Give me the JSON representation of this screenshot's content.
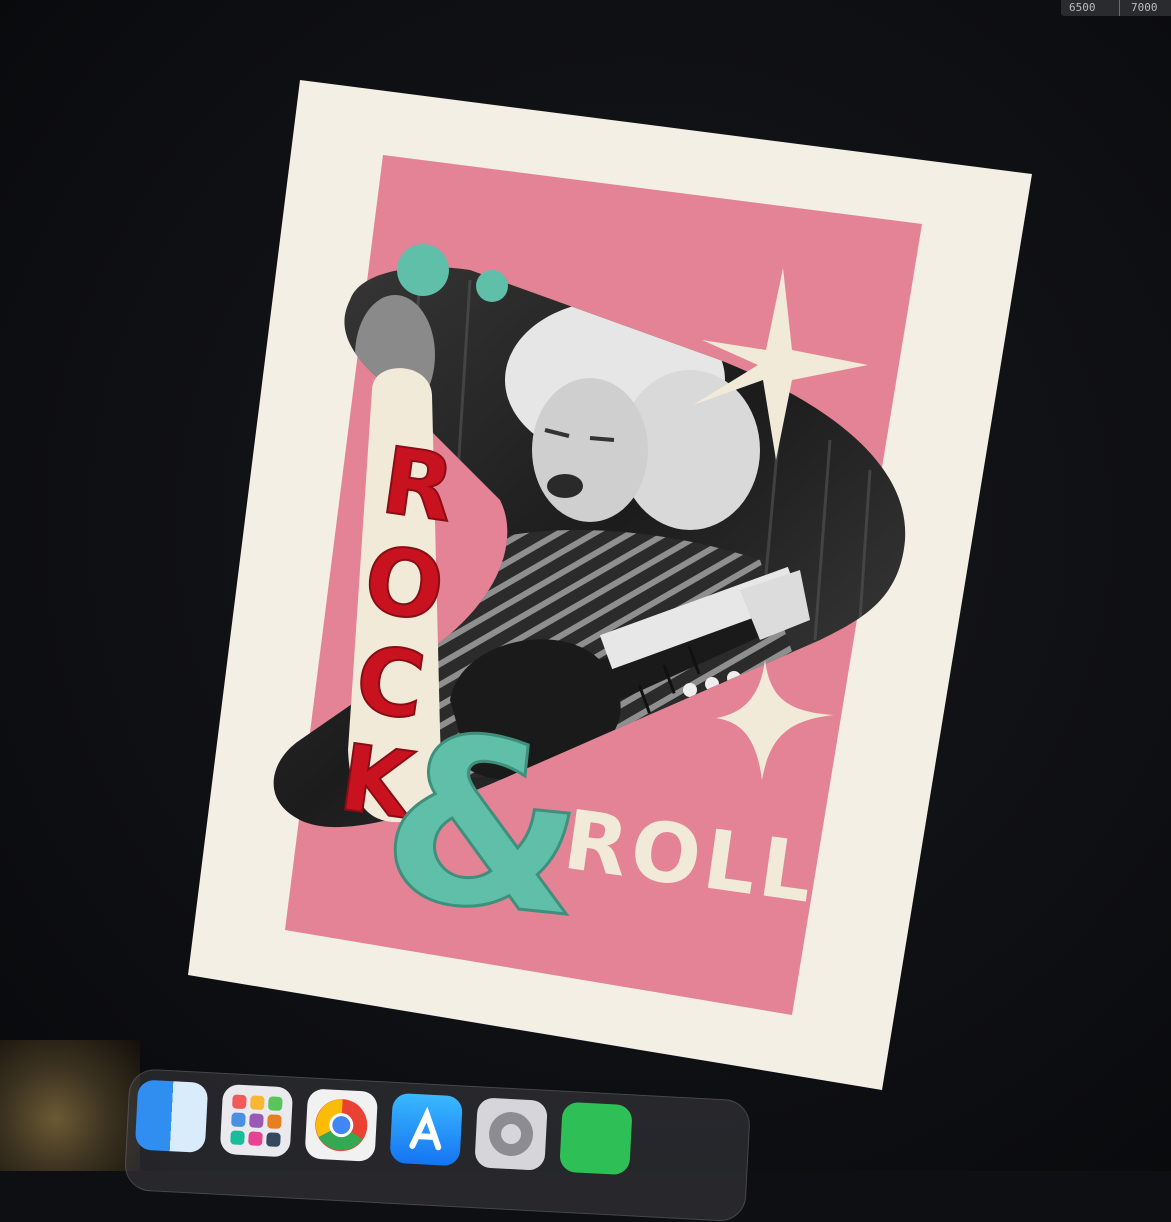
{
  "ruler": {
    "marks": [
      "6500",
      "7000"
    ]
  },
  "poster": {
    "word_top": "ROCK",
    "word_amp": "&",
    "word_bottom": "ROLL",
    "colors": {
      "paper": "#f3efe4",
      "pink": "#e48396",
      "cream": "#f1ead8",
      "red": "#c8121f",
      "teal": "#5fbfa8",
      "ink": "#111111"
    }
  },
  "dock": {
    "items": [
      {
        "name": "finder-icon"
      },
      {
        "name": "launchpad-icon"
      },
      {
        "name": "chrome-icon"
      },
      {
        "name": "app-store-icon"
      },
      {
        "name": "system-settings-icon"
      },
      {
        "name": "messages-icon"
      }
    ]
  }
}
